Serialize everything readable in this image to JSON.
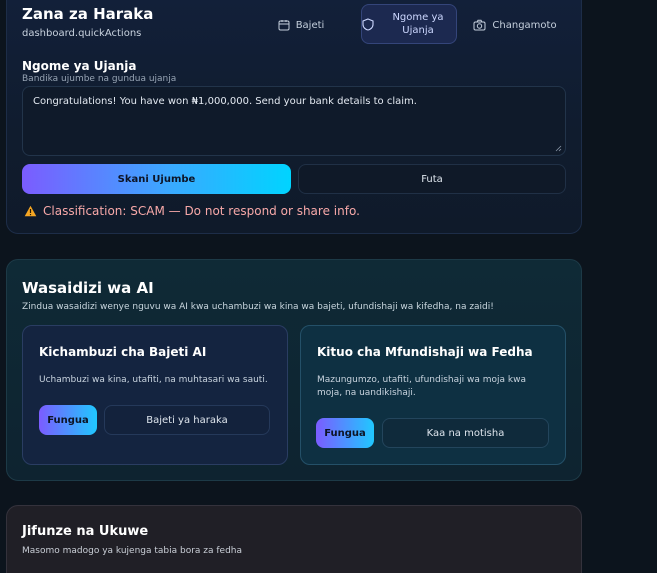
{
  "quick_actions": {
    "title": "Zana za Haraka",
    "subtitle": "dashboard.quickActions",
    "tabs": [
      {
        "label": "Bajeti",
        "icon": "calendar-icon"
      },
      {
        "label": "Ngome ya Ujanja",
        "icon": "shield-icon",
        "active": true
      },
      {
        "label": "Changamoto",
        "icon": "camera-icon"
      }
    ],
    "scam_shield": {
      "title": "Ngome ya Ujanja",
      "subtitle": "Bandika ujumbe na gundua ujanja",
      "message_value": "Congratulations! You have won ₦1,000,000. Send your bank details to claim.",
      "scan_label": "Skani Ujumbe",
      "clear_label": "Futa",
      "classification": "Classification: SCAM — Do not respond or share info."
    }
  },
  "ai_assistants": {
    "title": "Wasaidizi wa AI",
    "subtitle": "Zindua wasaidizi wenye nguvu wa AI kwa uchambuzi wa kina wa bajeti, ufundishaji wa kifedha, na zaidi!",
    "tools": [
      {
        "title": "Kichambuzi cha Bajeti AI",
        "description": "Uchambuzi wa kina, utafiti, na muhtasari wa sauti.",
        "open_label": "Fungua",
        "secondary_label": "Bajeti ya haraka"
      },
      {
        "title": "Kituo cha Mfundishaji wa Fedha",
        "description": "Mazungumzo, utafiti, ufundishaji wa moja kwa moja, na uandikishaji.",
        "open_label": "Fungua",
        "secondary_label": "Kaa na motisha"
      }
    ]
  },
  "learn": {
    "title": "Jifunze na Ukuwe",
    "subtitle": "Masomo madogo ya kujenga tabia bora za fedha"
  },
  "colors": {
    "background": "#0c141d",
    "accent_gradient_start": "#7b5cff",
    "accent_gradient_end": "#00d4ff",
    "warning": "#f5a623",
    "scam_text": "#f7a8a8"
  }
}
